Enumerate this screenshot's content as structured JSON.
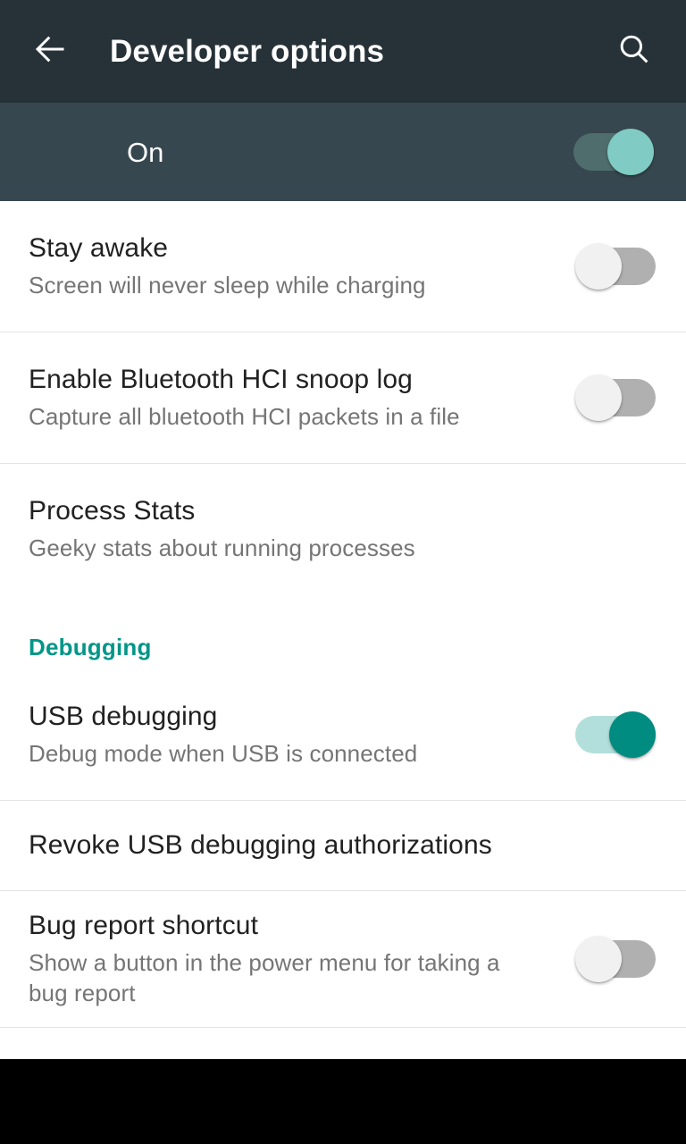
{
  "appbar": {
    "back_icon": "arrow-left-icon",
    "title": "Developer options",
    "search_icon": "search-icon"
  },
  "master_switch": {
    "label": "On",
    "state": "on"
  },
  "sections": [
    {
      "header": null,
      "items": [
        {
          "title": "Stay awake",
          "summary": "Screen will never sleep while charging",
          "widget": "switch",
          "state": "off"
        },
        {
          "title": "Enable Bluetooth HCI snoop log",
          "summary": "Capture all bluetooth HCI packets in a file",
          "widget": "switch",
          "state": "off"
        },
        {
          "title": "Process Stats",
          "summary": "Geeky stats about running processes",
          "widget": "none",
          "state": null
        }
      ]
    },
    {
      "header": "Debugging",
      "items": [
        {
          "title": "USB debugging",
          "summary": "Debug mode when USB is connected",
          "widget": "switch",
          "state": "on"
        },
        {
          "title": "Revoke USB debugging authorizations",
          "summary": null,
          "widget": "none",
          "state": null
        },
        {
          "title": "Bug report shortcut",
          "summary": "Show a button in the power menu for taking a bug report",
          "widget": "switch",
          "state": "off"
        }
      ]
    }
  ],
  "colors": {
    "appbar_background": "#263238",
    "master_row_background": "#37474f",
    "accent_teal": "#009688",
    "switch_on_track": "#b2dfdb",
    "switch_on_thumb": "#008c80",
    "switch_off_track": "#b0b0b0",
    "switch_off_thumb": "#f1f1f1",
    "title_text": "#212121",
    "summary_text": "#757575",
    "divider": "#e2e2e2",
    "navbar": "#000000"
  }
}
